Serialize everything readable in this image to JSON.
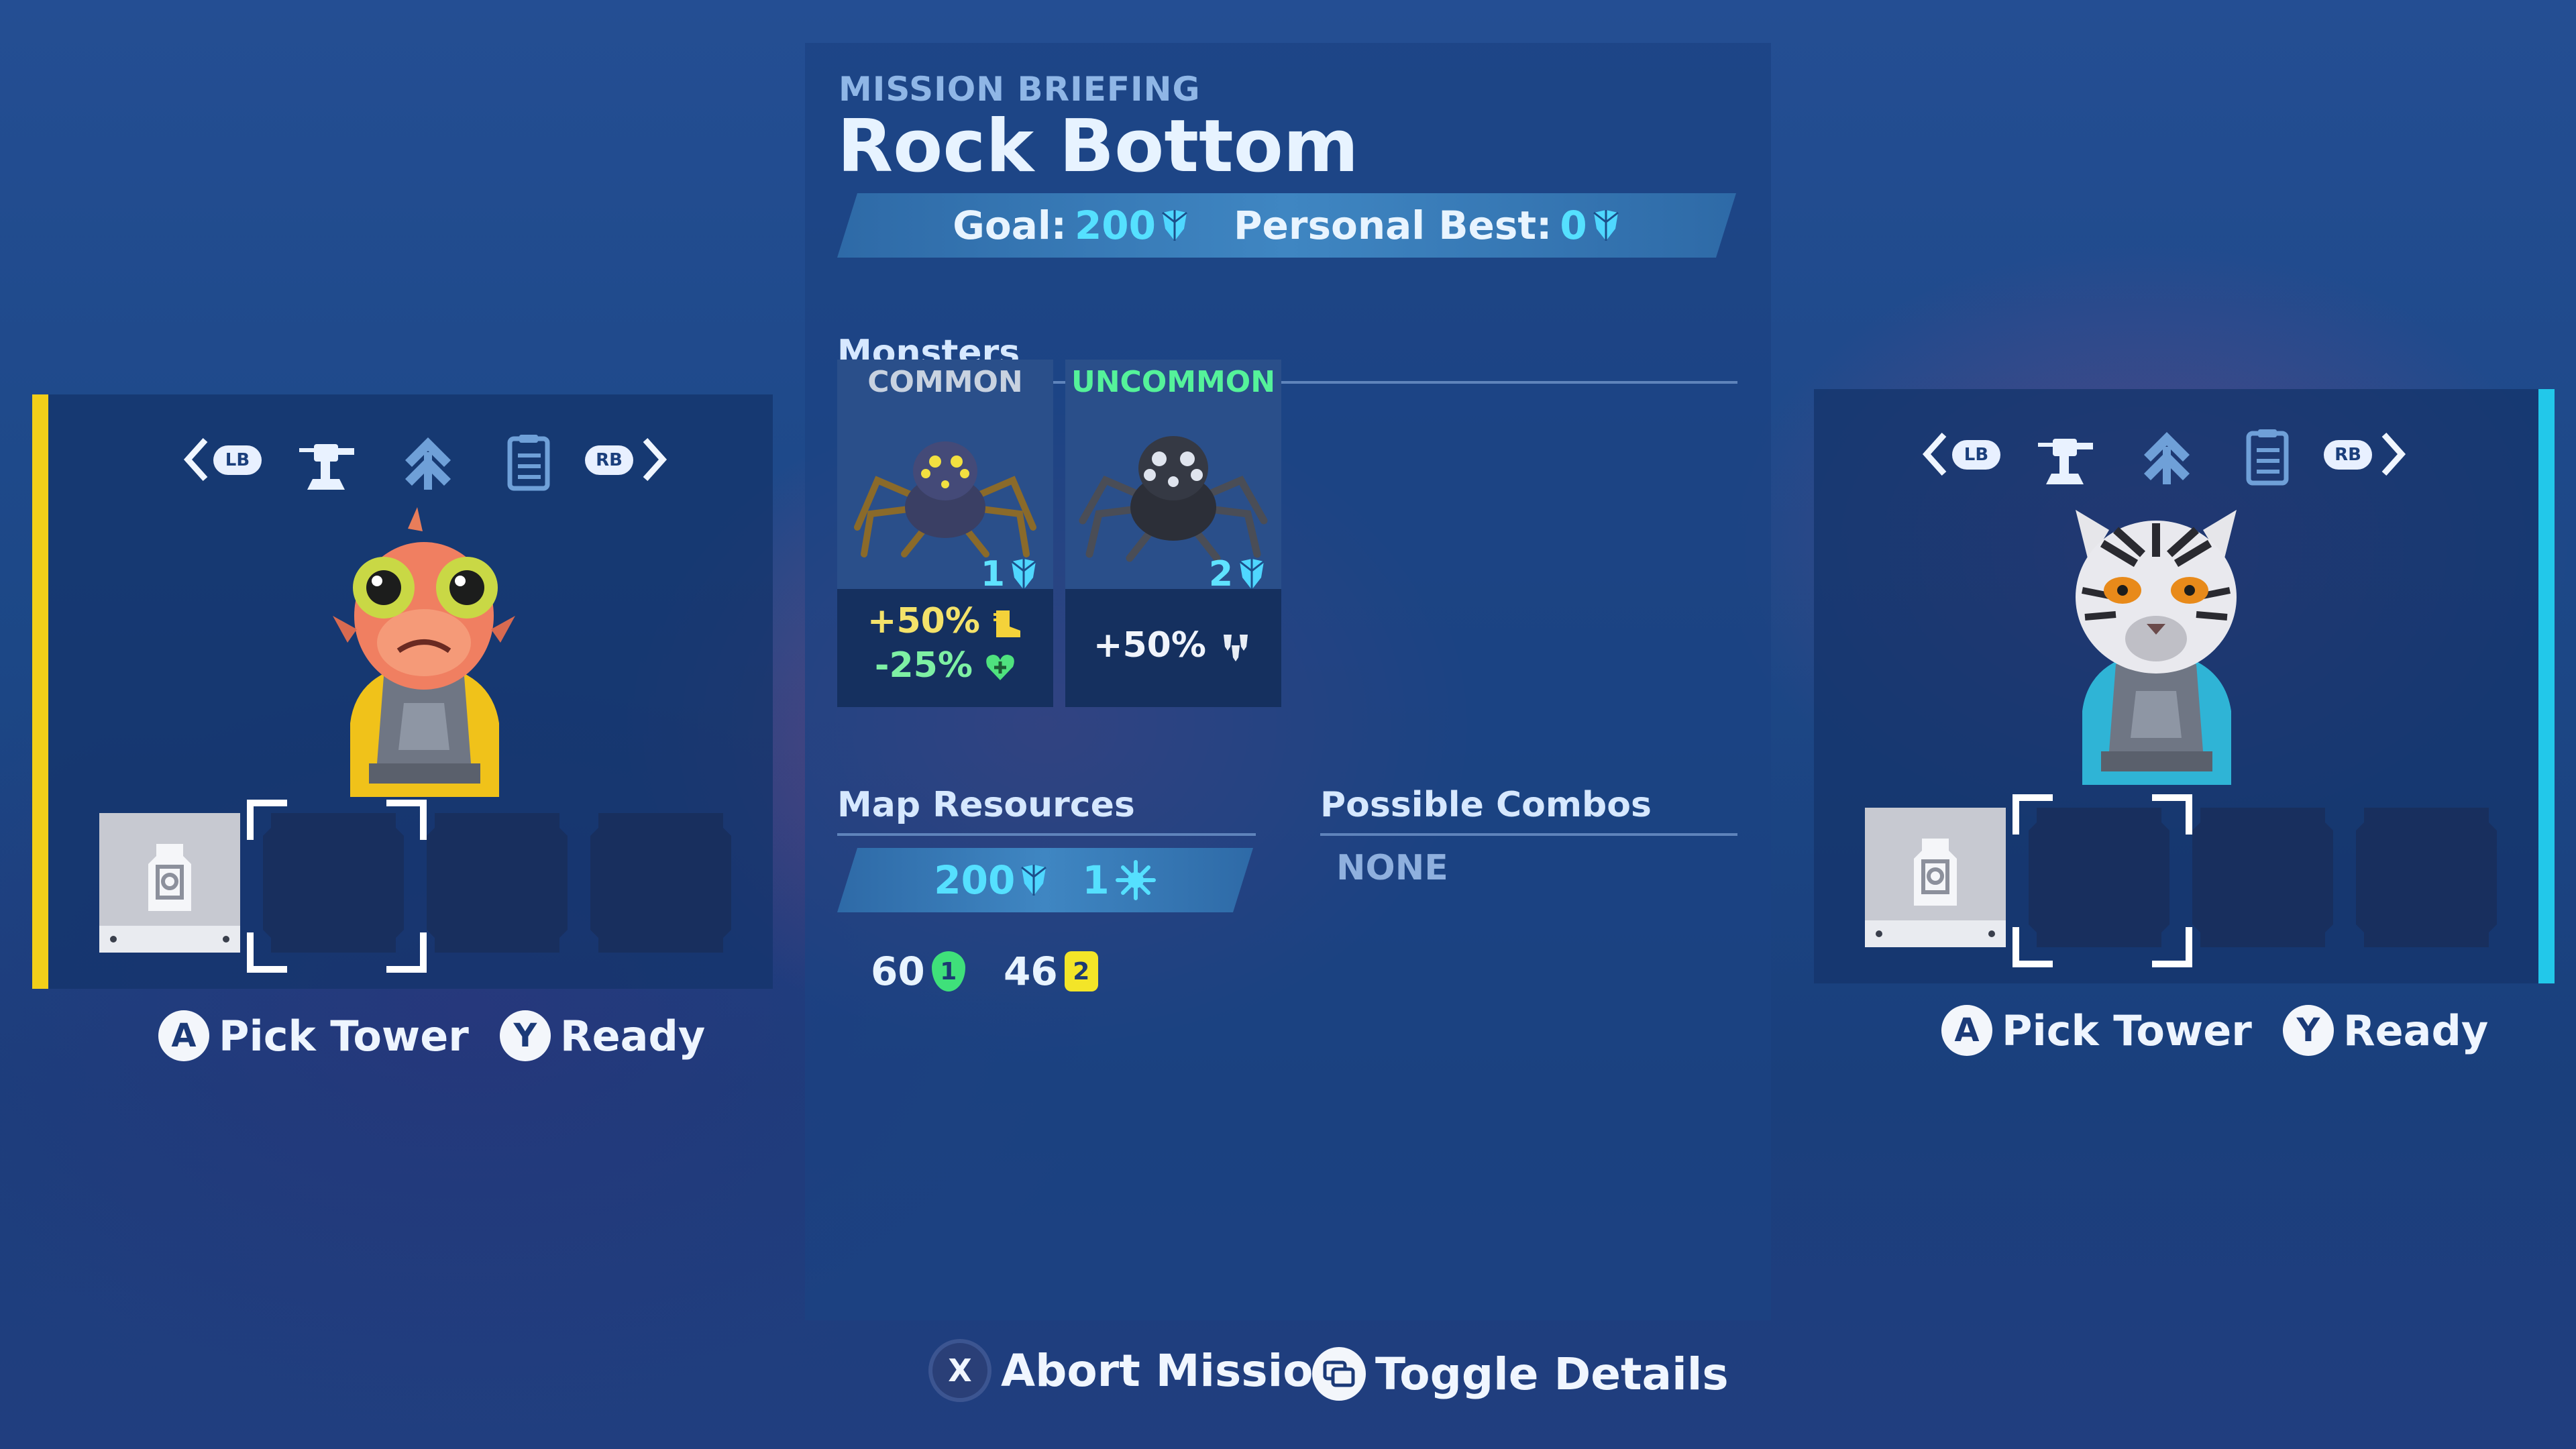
{
  "players": [
    {
      "id": "left",
      "accent": "#f2cf19",
      "bumpers": {
        "left": "LB",
        "right": "RB"
      },
      "tab_icons": [
        "turret-icon",
        "upgrade-chevrons-icon",
        "clipboard-icon"
      ],
      "character": "fish-character",
      "slots": [
        {
          "state": "tower",
          "icon": "tower-token-icon"
        },
        {
          "state": "selected-empty"
        },
        {
          "state": "empty"
        },
        {
          "state": "empty"
        }
      ],
      "prompts": {
        "a_button": "A",
        "a_label": "Pick Tower",
        "y_button": "Y",
        "y_label": "Ready"
      }
    },
    {
      "id": "right",
      "accent": "#22c8ea",
      "bumpers": {
        "left": "LB",
        "right": "RB"
      },
      "tab_icons": [
        "turret-icon",
        "upgrade-chevrons-icon",
        "clipboard-icon"
      ],
      "character": "tiger-character",
      "slots": [
        {
          "state": "tower",
          "icon": "tower-token-icon"
        },
        {
          "state": "selected-empty"
        },
        {
          "state": "empty"
        },
        {
          "state": "empty"
        }
      ],
      "prompts": {
        "a_button": "A",
        "a_label": "Pick Tower",
        "y_button": "Y",
        "y_label": "Ready"
      }
    }
  ],
  "briefing": {
    "kicker": "MISSION BRIEFING",
    "title": "Rock Bottom",
    "goal_label": "Goal:",
    "goal_value": "200",
    "best_label": "Personal Best:",
    "best_value": "0",
    "monsters_heading": "Monsters",
    "monsters": [
      {
        "rarity": "COMMON",
        "rarity_color": "#c8d2e0",
        "cost": "1",
        "mods": [
          {
            "text": "+50%",
            "color": "#f4e26a",
            "icon": "speed-boot-icon"
          },
          {
            "text": "-25%",
            "color": "#7ef0a4",
            "icon": "health-heart-icon"
          }
        ]
      },
      {
        "rarity": "UNCOMMON",
        "rarity_color": "#55f29a",
        "cost": "2",
        "mods": [
          {
            "text": "+50%",
            "color": "#f0f4fb",
            "icon": "spawn-group-icon"
          }
        ]
      }
    ],
    "map_resources_heading": "Map Resources",
    "resources": {
      "crystals": "200",
      "energy": "1"
    },
    "resource_counts": [
      {
        "value": "60",
        "badge": "1",
        "badge_color": "#3fe07a"
      },
      {
        "value": "46",
        "badge": "2",
        "badge_color": "#f3e528"
      }
    ],
    "combos_heading": "Possible Combos",
    "combos_value": "NONE"
  },
  "footer": {
    "abort_button": "X",
    "abort_label": "Abort Mission",
    "toggle_icon": "view-toggle-icon",
    "toggle_label": "Toggle Details"
  }
}
